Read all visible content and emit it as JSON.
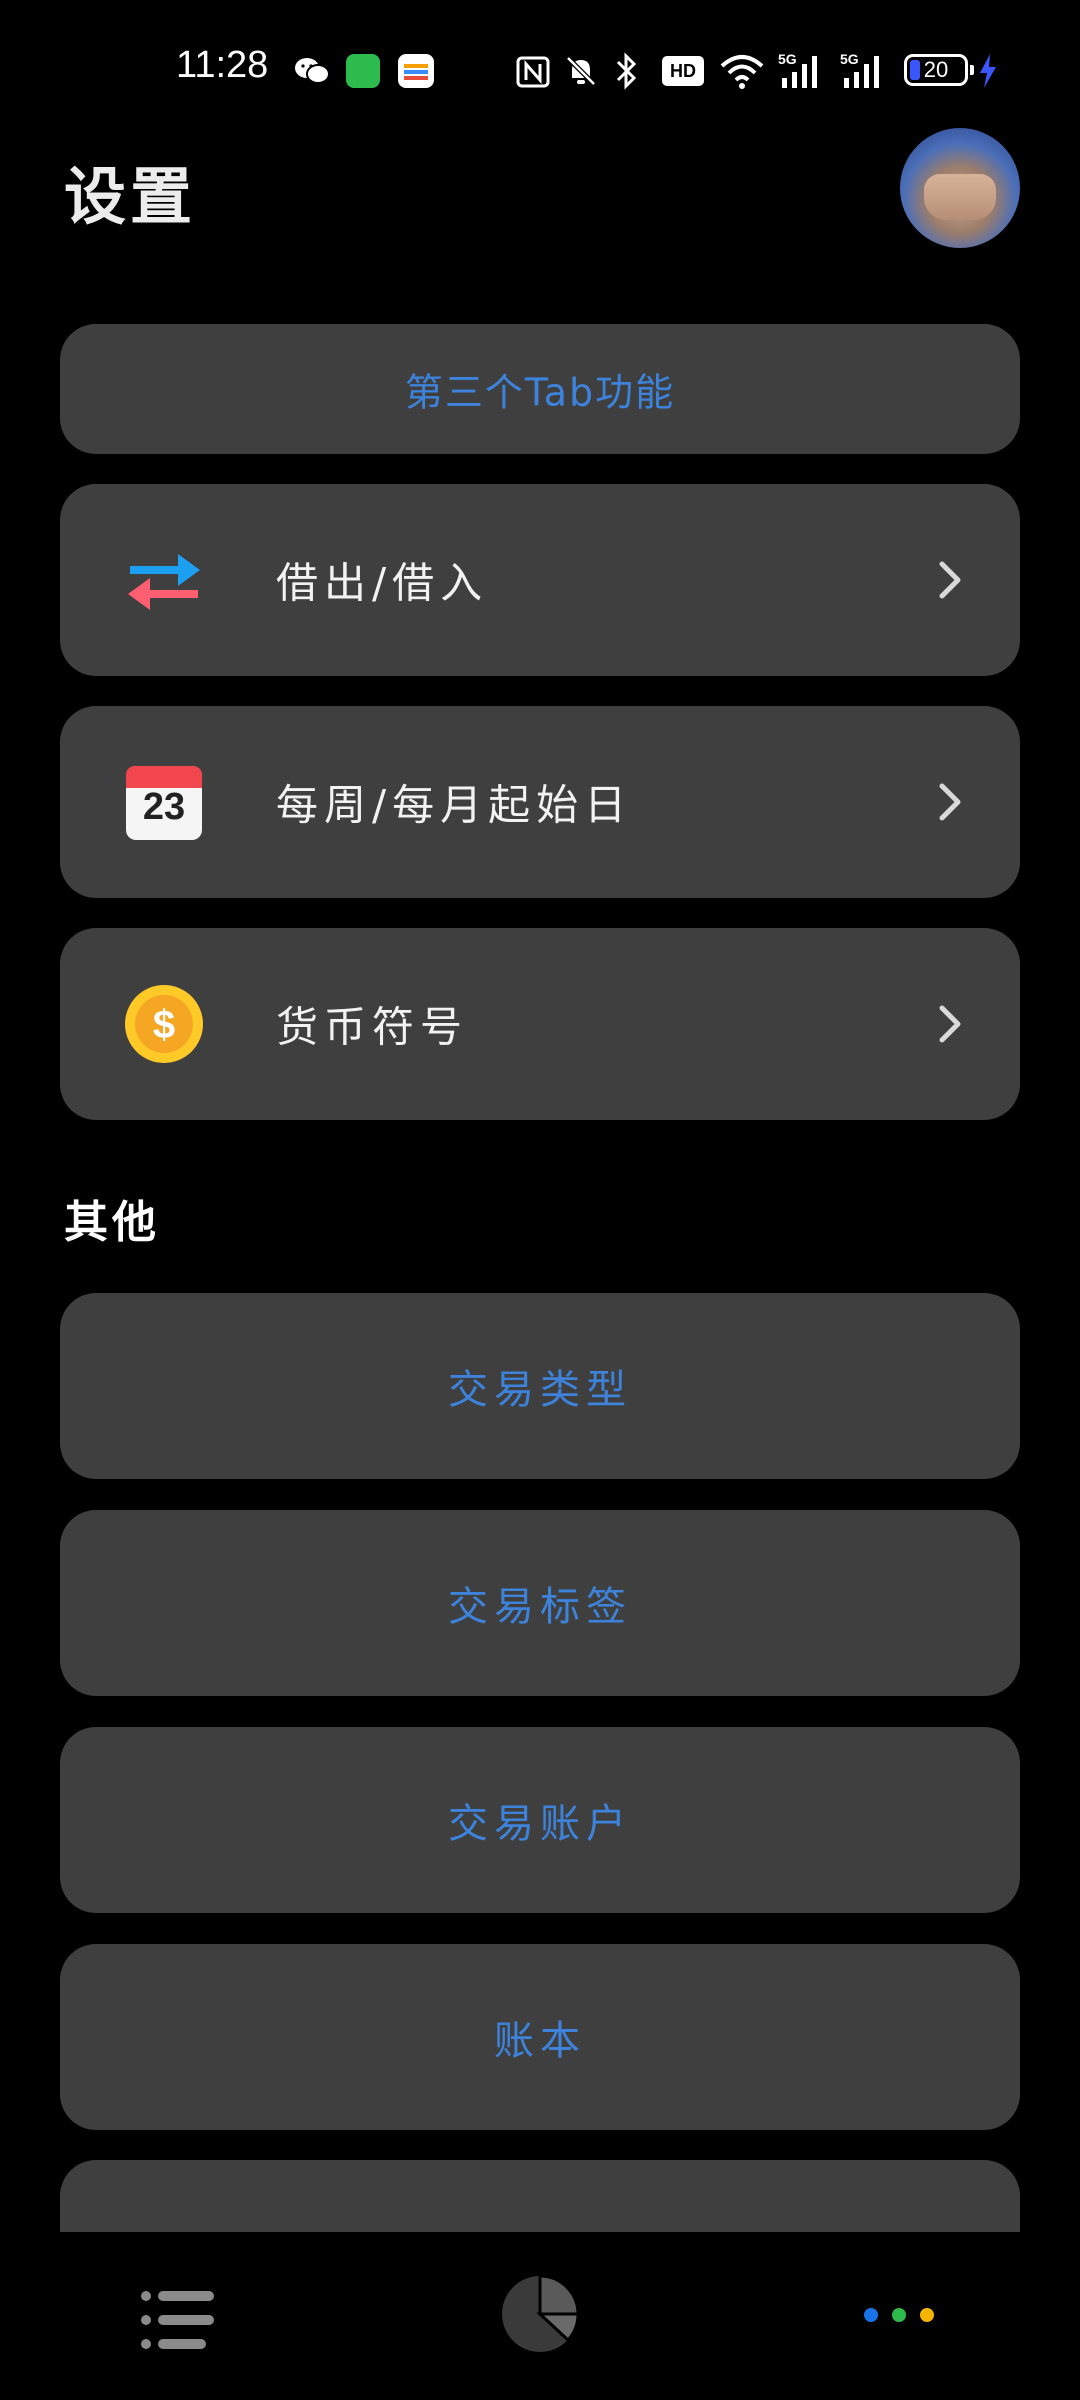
{
  "status_bar": {
    "time": "11:28",
    "battery_level": "20",
    "icons": [
      "wechat-icon",
      "app-icon",
      "wallet-icon",
      "nfc-icon",
      "mute-icon",
      "bluetooth-icon",
      "hd-icon",
      "wifi-icon",
      "signal-5g-icon",
      "signal-5g-icon",
      "battery-icon",
      "charging-icon"
    ]
  },
  "header": {
    "title": "设置"
  },
  "cards": {
    "tab3": "第三个Tab功能",
    "lend_borrow": "借出/借入",
    "start_day": "每周/每月起始日",
    "currency": "货币符号"
  },
  "calendar_day": "23",
  "other_section": {
    "title": "其他",
    "items": [
      "交易类型",
      "交易标签",
      "交易账户",
      "账本"
    ]
  },
  "bottom_nav": {
    "items": [
      "list-icon",
      "pie-chart-icon",
      "more-dots-icon"
    ],
    "dot_colors": [
      "#1a73e8",
      "#2dbb4e",
      "#f4b400"
    ]
  },
  "colors": {
    "accent_text": "#3d83dc",
    "card_bg": "#3f3f3f",
    "background": "#000000"
  }
}
